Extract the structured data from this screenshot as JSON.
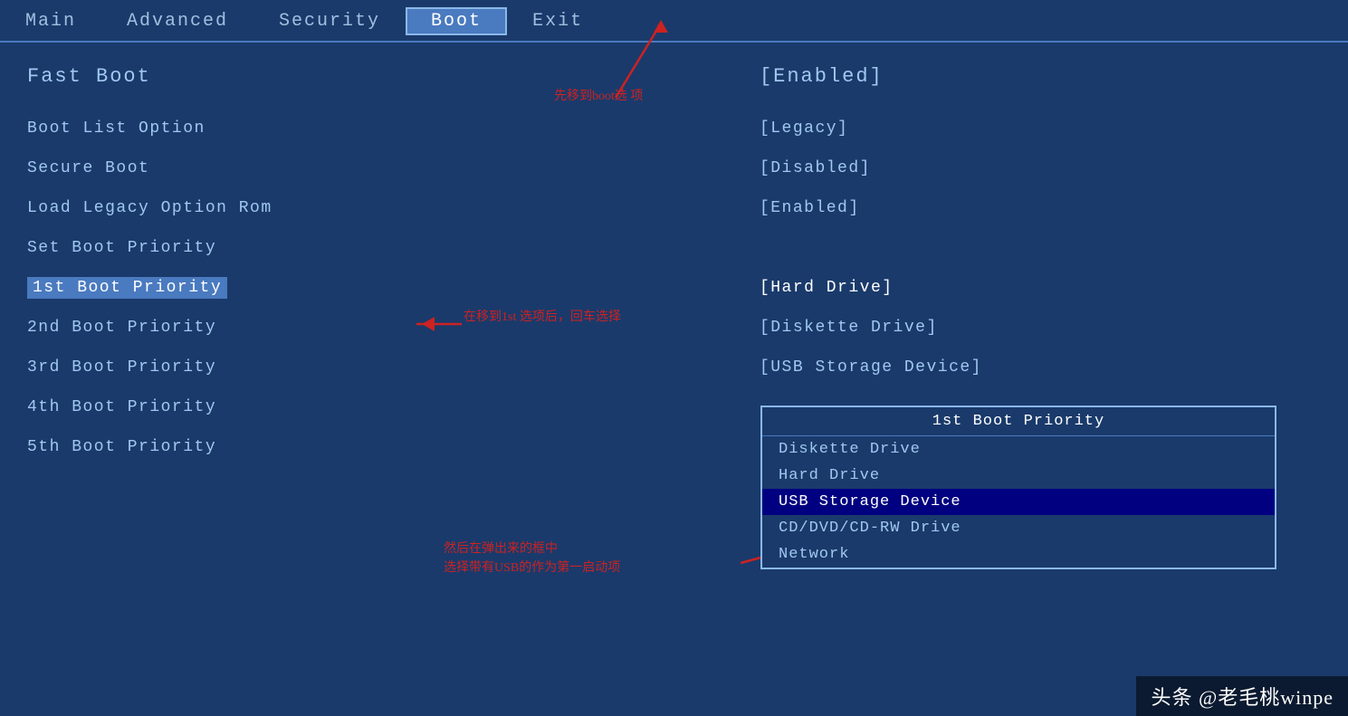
{
  "menu": {
    "items": [
      {
        "label": "Main",
        "active": false
      },
      {
        "label": "Advanced",
        "active": false
      },
      {
        "label": "Security",
        "active": false
      },
      {
        "label": "Boot",
        "active": true
      },
      {
        "label": "Exit",
        "active": false
      }
    ]
  },
  "settings": {
    "fast_boot": {
      "label": "Fast Boot",
      "value": "[Enabled]"
    },
    "rows": [
      {
        "label": "Boot List Option",
        "value": "[Legacy]"
      },
      {
        "label": "Secure Boot",
        "value": "[Disabled]"
      },
      {
        "label": "Load Legacy Option Rom",
        "value": "[Enabled]"
      },
      {
        "label": "Set Boot Priority",
        "value": ""
      },
      {
        "label": "1st Boot Priority",
        "value": "[Hard Drive]",
        "highlighted": true
      },
      {
        "label": "2nd Boot Priority",
        "value": "[Diskette Drive]"
      },
      {
        "label": "3rd Boot Priority",
        "value": "[USB Storage Device]"
      },
      {
        "label": "4th Boot Priority",
        "value": ""
      },
      {
        "label": "5th Boot Priority",
        "value": ""
      }
    ]
  },
  "popup": {
    "title": "1st Boot Priority",
    "items": [
      {
        "label": "Diskette Drive",
        "selected": false
      },
      {
        "label": "Hard Drive",
        "selected": false
      },
      {
        "label": "USB Storage Device",
        "selected": true
      },
      {
        "label": "CD/DVD/CD-RW Drive",
        "selected": false
      },
      {
        "label": "Network",
        "selected": false
      }
    ]
  },
  "annotations": {
    "arrow1_text": "先移到boot选\n项",
    "arrow2_text": "在移到1st 选项后，回车选择",
    "arrow3_text": "然后在弹出来的框中\n选择带有USB的作为第一启动项"
  },
  "watermark": "头条 @老毛桃winpe"
}
